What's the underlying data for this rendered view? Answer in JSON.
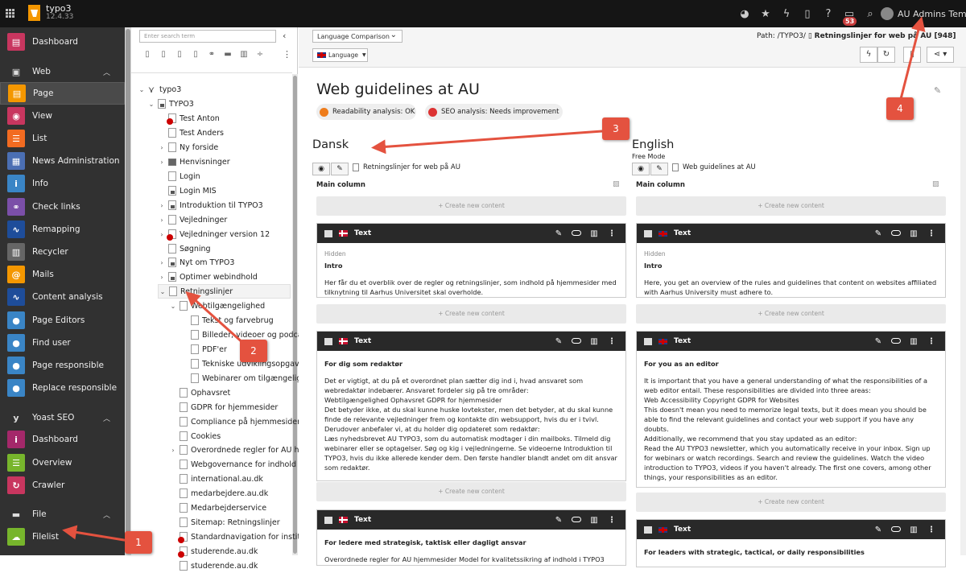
{
  "topbar": {
    "app": "typo3",
    "version": "12.4.33",
    "badge_count": "53",
    "user": "AU Admins Template"
  },
  "modules": {
    "dashboard": "Dashboard",
    "web": "Web",
    "page": "Page",
    "view": "View",
    "list": "List",
    "news": "News Administration",
    "info": "Info",
    "checklinks": "Check links",
    "remapping": "Remapping",
    "recycler": "Recycler",
    "mails": "Mails",
    "content_analysis": "Content analysis",
    "page_editors": "Page Editors",
    "find_user": "Find user",
    "page_responsible": "Page responsible",
    "replace_responsible": "Replace responsible",
    "yoast": "Yoast SEO",
    "yoast_dashboard": "Dashboard",
    "overview": "Overview",
    "crawler": "Crawler",
    "file": "File",
    "filelist": "Filelist"
  },
  "tree": {
    "search_placeholder": "Enter search term",
    "nodes": [
      "typo3",
      "TYPO3",
      "Test Anton",
      "Test Anders",
      "Ny forside",
      "Henvisninger",
      "Login",
      "Login MIS",
      "Introduktion til TYPO3",
      "Vejledninger",
      "Vejledninger version 12",
      "Søgning",
      "Nyt om TYPO3",
      "Optimer webindhold",
      "Retningslinjer",
      "Webtilgængelighed",
      "Tekst og farvebrug",
      "Billeder, videoer og podcasts",
      "PDF'er",
      "Tekniske udviklingsopgaver",
      "Webinarer om tilgængelighed",
      "Ophavsret",
      "GDPR for hjemmesider",
      "Compliance på hjemmesider",
      "Cookies",
      "Overordnede regler for AU hjemmesider",
      "Webgovernance for indhold i TYPO3",
      "international.au.dk",
      "medarbejdere.au.dk",
      "Medarbejderservice",
      "Sitemap: Retningslinjer",
      "Standardnavigation for institutter",
      "studerende.au.dk",
      "studerende.au.dk"
    ]
  },
  "docheader": {
    "view_select": "Language Comparison",
    "language_button": "Language",
    "path_label": "Path: /TYPO3/",
    "path_page": "Retningslinjer for web på AU [948]"
  },
  "page": {
    "title": "Web guidelines at AU",
    "readability": "Readability analysis: OK",
    "seo": "SEO analysis: Needs improvement"
  },
  "columns": {
    "main_column": "Main column",
    "create_new": "+ Create new content",
    "left": {
      "lang": "Dansk",
      "record_title": "Retningslinjer for web på AU",
      "cards": [
        {
          "type": "Text",
          "hidden": "Hidden",
          "heading": "Intro",
          "body": "Her får du et overblik over de regler og retningslinjer, som indhold på hjemmesider med tilknytning til Aarhus Universitet skal overholde."
        },
        {
          "type": "Text",
          "hidden": "",
          "heading": "For dig som redaktør",
          "body": "Det er vigtigt, at du på et overordnet plan sætter dig ind i, hvad ansvaret som webredaktør indebærer. Ansvaret fordeler sig på tre områder:\nWebtilgængelighed Ophavsret GDPR for hjemmesider\nDet betyder ikke, at du skal kunne huske lovtekster, men det betyder, at du skal kunne finde de relevante vejledninger frem og kontakte din websupport, hvis du er i tvivl.\nDerudover anbefaler vi, at du holder dig opdateret som redaktør:\nLæs nyhedsbrevet AU TYPO3, som du automatisk modtager i din mailboks.  Tilmeld dig webinarer eller se optagelser. Søg og kig i vejledningerne. Se videoerne Introduktion til TYPO3, hvis du ikke allerede kender dem. Den første handler blandt andet om dit ansvar som redaktør."
        },
        {
          "type": "Text",
          "hidden": "",
          "heading": "For ledere med strategisk, taktisk eller dagligt ansvar",
          "body": "Overordnede regler for AU hjemmesider Model for kvalitetssikring af indhold i TYPO3"
        }
      ]
    },
    "right": {
      "lang": "English",
      "mode": "Free Mode",
      "record_title": "Web guidelines at AU",
      "cards": [
        {
          "type": "Text",
          "hidden": "Hidden",
          "heading": "Intro",
          "body": "Here, you get an overview of the rules and guidelines that content on websites affiliated with Aarhus University must adhere to."
        },
        {
          "type": "Text",
          "hidden": "",
          "heading": "For you as an editor",
          "body": "It is important that you have a general understanding of what the responsibilities of a web editor entail. These responsibilities are divided into three areas:\nWeb Accessibility Copyright GDPR for Websites\nThis doesn't mean you need to memorize legal texts, but it does mean you should be able to find the relevant guidelines and contact your web support if you have any doubts.\nAdditionally, we recommend that you stay updated as an editor:\nRead the AU TYPO3 newsletter, which you automatically receive in your inbox. Sign up for webinars or watch recordings. Search and review the guidelines. Watch the video introduction to TYPO3, videos if you haven't already. The first one covers, among other things, your responsibilities as an editor."
        },
        {
          "type": "Text",
          "hidden": "",
          "heading": "For leaders with strategic, tactical, or daily responsibilities",
          "body": ""
        }
      ]
    }
  },
  "annotations": [
    "1",
    "2",
    "3",
    "4"
  ],
  "colors": {
    "annotation": "#e4523f",
    "topbar": "#151515",
    "module_menu": "#313131",
    "typo3_orange": "#f49700"
  }
}
